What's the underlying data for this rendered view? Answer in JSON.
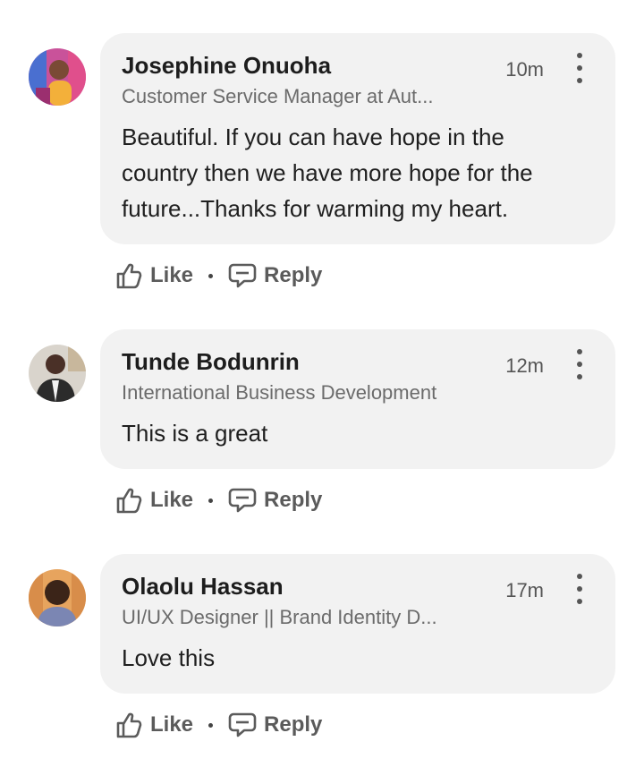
{
  "comments": [
    {
      "author": "Josephine Onuoha",
      "headline": "Customer Service Manager at Aut...",
      "time": "10m",
      "text": "Beautiful. If you can have hope in the country then we have more hope for the future...Thanks for warming my heart.",
      "like_label": "Like",
      "reply_label": "Reply"
    },
    {
      "author": "Tunde Bodunrin",
      "headline": "International Business Development",
      "time": "12m",
      "text": "This is a great",
      "like_label": "Like",
      "reply_label": "Reply"
    },
    {
      "author": "Olaolu Hassan",
      "headline": "UI/UX Designer || Brand Identity D...",
      "time": "17m",
      "text": "Love this",
      "like_label": "Like",
      "reply_label": "Reply"
    }
  ],
  "icons": {
    "like": "thumbs-up-icon",
    "reply": "speech-bubble-icon",
    "more": "vertical-ellipsis-icon"
  },
  "colors": {
    "bubble_bg": "#f2f2f2",
    "secondary_text": "#6b6b6b",
    "action_text": "#5b5b5b"
  }
}
